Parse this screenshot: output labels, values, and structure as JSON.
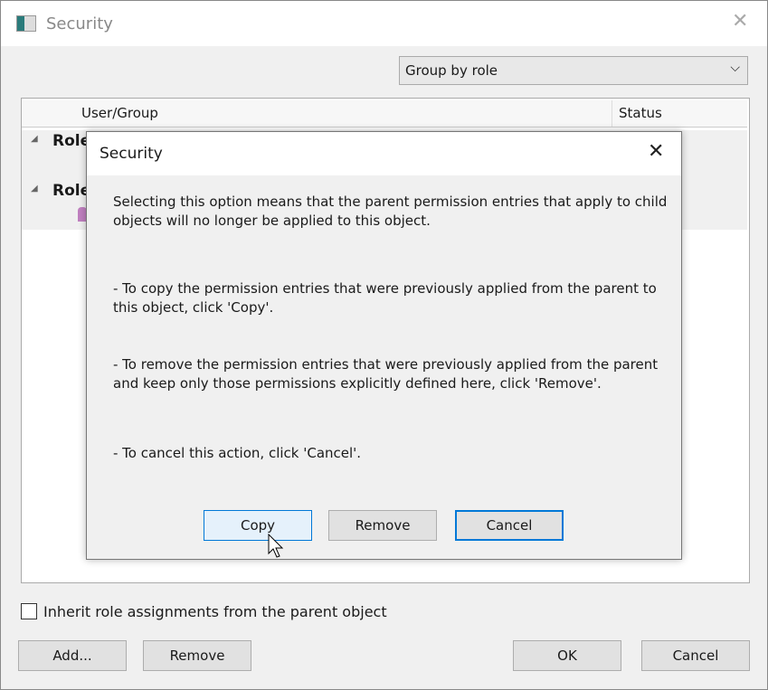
{
  "window": {
    "title": "Security",
    "close_icon": "close-icon"
  },
  "group_select": {
    "value": "Group by role"
  },
  "list": {
    "columns": [
      "User/Group",
      "Status"
    ],
    "rows": [
      {
        "label": "Role"
      },
      {
        "label": "Role"
      }
    ]
  },
  "dialog": {
    "title": "Security",
    "paragraphs": [
      "Selecting this option means that the parent permission entries that apply to child objects will no longer be applied to this object.",
      "- To copy  the permission entries that were previously applied from the parent to this object, click 'Copy'.",
      "- To remove the permission entries that were previously applied from the parent and keep only those permissions explicitly defined here, click 'Remove'.",
      "- To cancel this action, click 'Cancel'."
    ],
    "buttons": {
      "copy": "Copy",
      "remove": "Remove",
      "cancel": "Cancel"
    }
  },
  "inherit_checkbox": {
    "label": "Inherit role assignments from the parent object",
    "checked": false
  },
  "buttons": {
    "add": "Add...",
    "remove": "Remove",
    "ok": "OK",
    "cancel": "Cancel"
  },
  "colors": {
    "accent": "#0078d7"
  }
}
